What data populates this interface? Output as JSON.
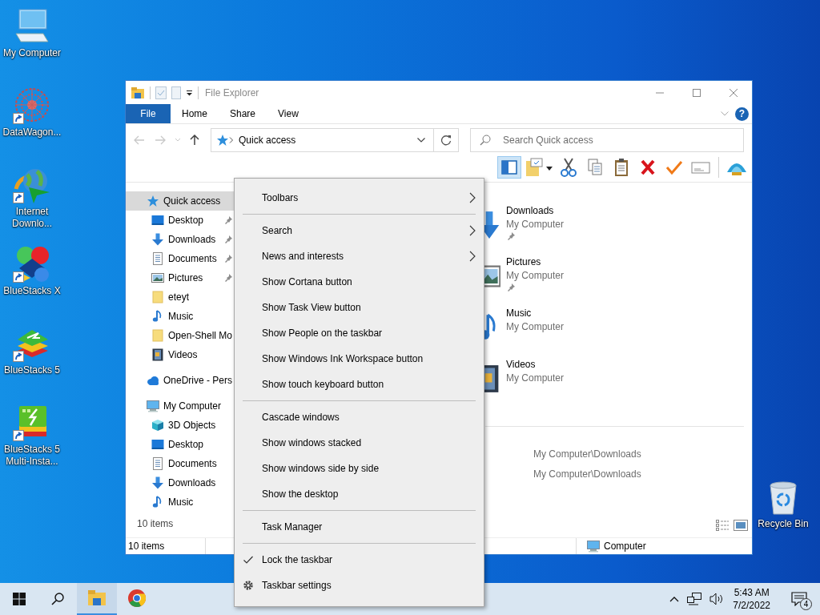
{
  "desktop_icons": [
    {
      "label": "My Computer",
      "kind": "computer",
      "shortcut": false
    },
    {
      "label": "DataWagon...",
      "kind": "datawagon",
      "shortcut": true
    },
    {
      "label": "Internet Downlo...",
      "kind": "downloader",
      "shortcut": true
    },
    {
      "label": "BlueStacks X",
      "kind": "bluestacks-x",
      "shortcut": true
    },
    {
      "label": "BlueStacks 5",
      "kind": "bluestacks",
      "shortcut": true
    },
    {
      "label": "BlueStacks 5 Multi-Insta...",
      "kind": "multi-instance",
      "shortcut": true
    }
  ],
  "recycle_bin": {
    "label": "Recycle Bin"
  },
  "explorer": {
    "title": "File Explorer",
    "ribbon_tabs": [
      {
        "label": "File",
        "kind": "file"
      },
      {
        "label": "Home",
        "kind": "tab"
      },
      {
        "label": "Share",
        "kind": "tab"
      },
      {
        "label": "View",
        "kind": "tab"
      }
    ],
    "help": "?",
    "address": {
      "path": "Quick access"
    },
    "search": {
      "placeholder": "Search Quick access"
    },
    "toolbar": [
      {
        "kind": "pane",
        "on": true
      },
      {
        "kind": "folder-options",
        "on": false
      },
      {
        "kind": "cut",
        "on": false
      },
      {
        "kind": "copy",
        "on": false
      },
      {
        "kind": "paste",
        "on": false
      },
      {
        "kind": "delete",
        "on": false
      },
      {
        "kind": "check",
        "on": false
      },
      {
        "kind": "mail",
        "on": false
      },
      {
        "kind": "shell",
        "on": false
      }
    ],
    "navigation": [
      {
        "label": "Quick access",
        "kind": "star",
        "selected": true,
        "pinned": false,
        "children": [
          {
            "label": "Desktop",
            "kind": "desktop",
            "selected": false,
            "pinned": true
          },
          {
            "label": "Downloads",
            "kind": "download",
            "selected": false,
            "pinned": true
          },
          {
            "label": "Documents",
            "kind": "document",
            "selected": false,
            "pinned": true
          },
          {
            "label": "Pictures",
            "kind": "picture",
            "selected": false,
            "pinned": true
          },
          {
            "label": "eteyt",
            "kind": "folder",
            "selected": false,
            "pinned": false
          },
          {
            "label": "Music",
            "kind": "music",
            "selected": false,
            "pinned": false
          },
          {
            "label": "Open-Shell Mo",
            "kind": "folder",
            "selected": false,
            "pinned": false
          },
          {
            "label": "Videos",
            "kind": "video",
            "selected": false,
            "pinned": false
          }
        ]
      },
      {
        "label": "OneDrive - Pers",
        "kind": "cloud",
        "selected": false,
        "pinned": false
      },
      {
        "label": "My Computer",
        "kind": "computer",
        "selected": false,
        "pinned": false,
        "children": [
          {
            "label": "3D Objects",
            "kind": "cube",
            "selected": false,
            "pinned": false
          },
          {
            "label": "Desktop",
            "kind": "desktop",
            "selected": false,
            "pinned": false
          },
          {
            "label": "Documents",
            "kind": "document",
            "selected": false,
            "pinned": false
          },
          {
            "label": "Downloads",
            "kind": "download",
            "selected": false,
            "pinned": false
          },
          {
            "label": "Music",
            "kind": "music",
            "selected": false,
            "pinned": false
          }
        ]
      }
    ],
    "nav_footer": "10 items",
    "frequent_folders": [
      {
        "title": "Downloads",
        "subtitle": "My Computer",
        "kind": "download",
        "pinned": true
      },
      {
        "title": "Pictures",
        "subtitle": "My Computer",
        "kind": "picture",
        "pinned": true
      },
      {
        "title": "Music",
        "subtitle": "My Computer",
        "kind": "music",
        "pinned": false
      },
      {
        "title": "Videos",
        "subtitle": "My Computer",
        "kind": "video",
        "pinned": false
      }
    ],
    "recent_files": [
      {
        "path": "My Computer\\Downloads"
      },
      {
        "path": "My Computer\\Downloads"
      }
    ],
    "status_bar": {
      "item_count": "10 items",
      "location": "Computer"
    }
  },
  "context_menu": {
    "groups": [
      [
        {
          "label": "Toolbars",
          "kind": "command",
          "submenu": true,
          "checked": false
        }
      ],
      [
        {
          "label": "Search",
          "kind": "command",
          "submenu": true,
          "checked": false
        },
        {
          "label": "News and interests",
          "kind": "command",
          "submenu": true,
          "checked": false
        },
        {
          "label": "Show Cortana button",
          "kind": "command",
          "submenu": false,
          "checked": false
        },
        {
          "label": "Show Task View button",
          "kind": "command",
          "submenu": false,
          "checked": false
        },
        {
          "label": "Show People on the taskbar",
          "kind": "command",
          "submenu": false,
          "checked": false
        },
        {
          "label": "Show Windows Ink Workspace button",
          "kind": "command",
          "submenu": false,
          "checked": false
        },
        {
          "label": "Show touch keyboard button",
          "kind": "command",
          "submenu": false,
          "checked": false
        }
      ],
      [
        {
          "label": "Cascade windows",
          "kind": "command",
          "submenu": false,
          "checked": false
        },
        {
          "label": "Show windows stacked",
          "kind": "command",
          "submenu": false,
          "checked": false
        },
        {
          "label": "Show windows side by side",
          "kind": "command",
          "submenu": false,
          "checked": false
        },
        {
          "label": "Show the desktop",
          "kind": "command",
          "submenu": false,
          "checked": false
        }
      ],
      [
        {
          "label": "Task Manager",
          "kind": "command",
          "submenu": false,
          "checked": false
        }
      ],
      [
        {
          "label": "Lock the taskbar",
          "kind": "command",
          "submenu": false,
          "checked": true
        },
        {
          "label": "Taskbar settings",
          "kind": "settings",
          "submenu": false,
          "checked": false
        }
      ]
    ]
  },
  "taskbar": {
    "pinned": [
      {
        "kind": "explorer",
        "active": true
      },
      {
        "kind": "chrome",
        "active": false
      }
    ],
    "time": "5:43 AM",
    "date": "7/2/2022",
    "notifications": "4"
  }
}
